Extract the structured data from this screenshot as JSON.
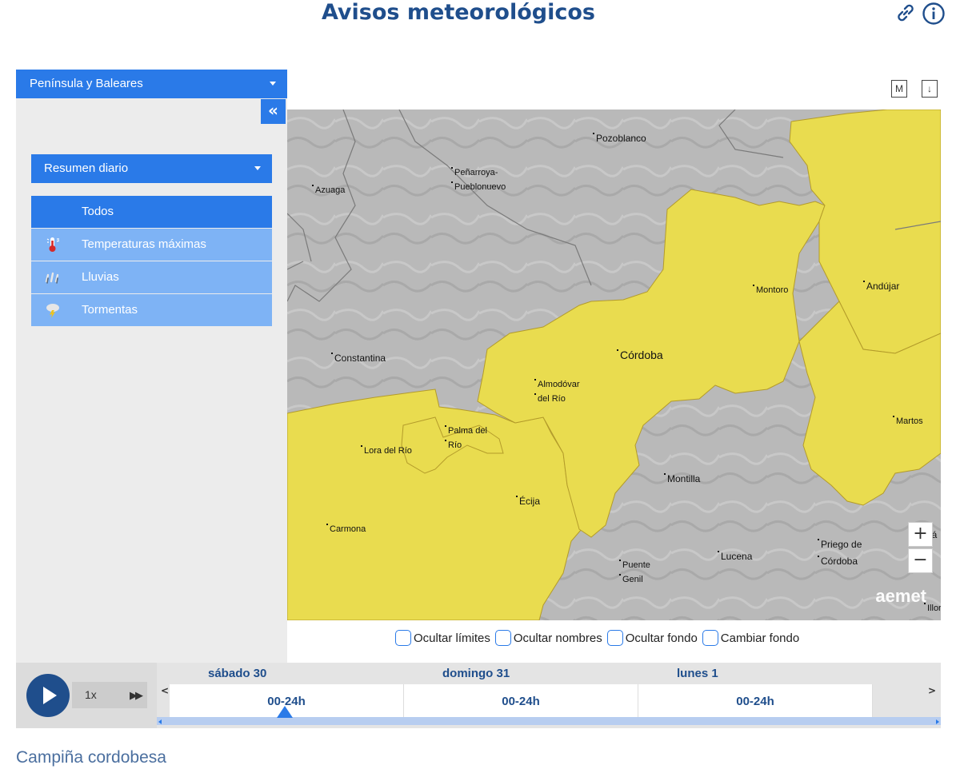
{
  "page": {
    "title": "Avisos meteorológicos"
  },
  "top_icons": [
    "link-icon",
    "info-icon"
  ],
  "sidebar": {
    "region": "Península y Baleares",
    "collapse_label": "«",
    "mode": "Resumen diario",
    "phenomena": [
      {
        "label": "Todos",
        "icon": "none",
        "active": true
      },
      {
        "label": "Temperaturas máximas",
        "icon": "thermometer-icon",
        "active": false
      },
      {
        "label": "Lluvias",
        "icon": "rain-icon",
        "active": false
      },
      {
        "label": "Tormentas",
        "icon": "storm-icon",
        "active": false
      }
    ]
  },
  "map_tools": {
    "m_label": "M",
    "download_label": "↓"
  },
  "map": {
    "places": [
      "Pozoblanco",
      "Peñarroya-",
      "Pueblonuevo",
      "Azuaga",
      "Montoro",
      "Andújar",
      "Constantina",
      "Córdoba",
      "Almodóvar",
      "del Río",
      "Martos",
      "Palma del",
      "Río",
      "Lora del Río",
      "Montilla",
      "Écija",
      "Carmona",
      "Priego de",
      "Córdoba",
      "Lucena",
      "Puente",
      "Genil",
      "lá",
      "Illor"
    ],
    "zoom_in": "+",
    "zoom_out": "−",
    "logo": "aemet",
    "colors": {
      "warning_yellow": "#e9dc4f",
      "terrain": "#b9b9b9",
      "border": "#7a7a7a"
    }
  },
  "options": {
    "hide_limits": "Ocultar límites",
    "hide_names": "Ocultar nombres",
    "hide_background": "Ocultar fondo",
    "change_background": "Cambiar fondo"
  },
  "timeline": {
    "speed": "1x",
    "prev": "<",
    "next": ">",
    "days": [
      {
        "name": "sábado 30",
        "slot": "00-24h"
      },
      {
        "name": "domingo 31",
        "slot": "00-24h"
      },
      {
        "name": "lunes 1",
        "slot": "00-24h"
      }
    ]
  },
  "zone": {
    "name": "Campiña cordobesa"
  },
  "colors": {
    "primary": "#2a7ae8",
    "light": "#7eb3f5",
    "dark": "#1f4e8c"
  }
}
